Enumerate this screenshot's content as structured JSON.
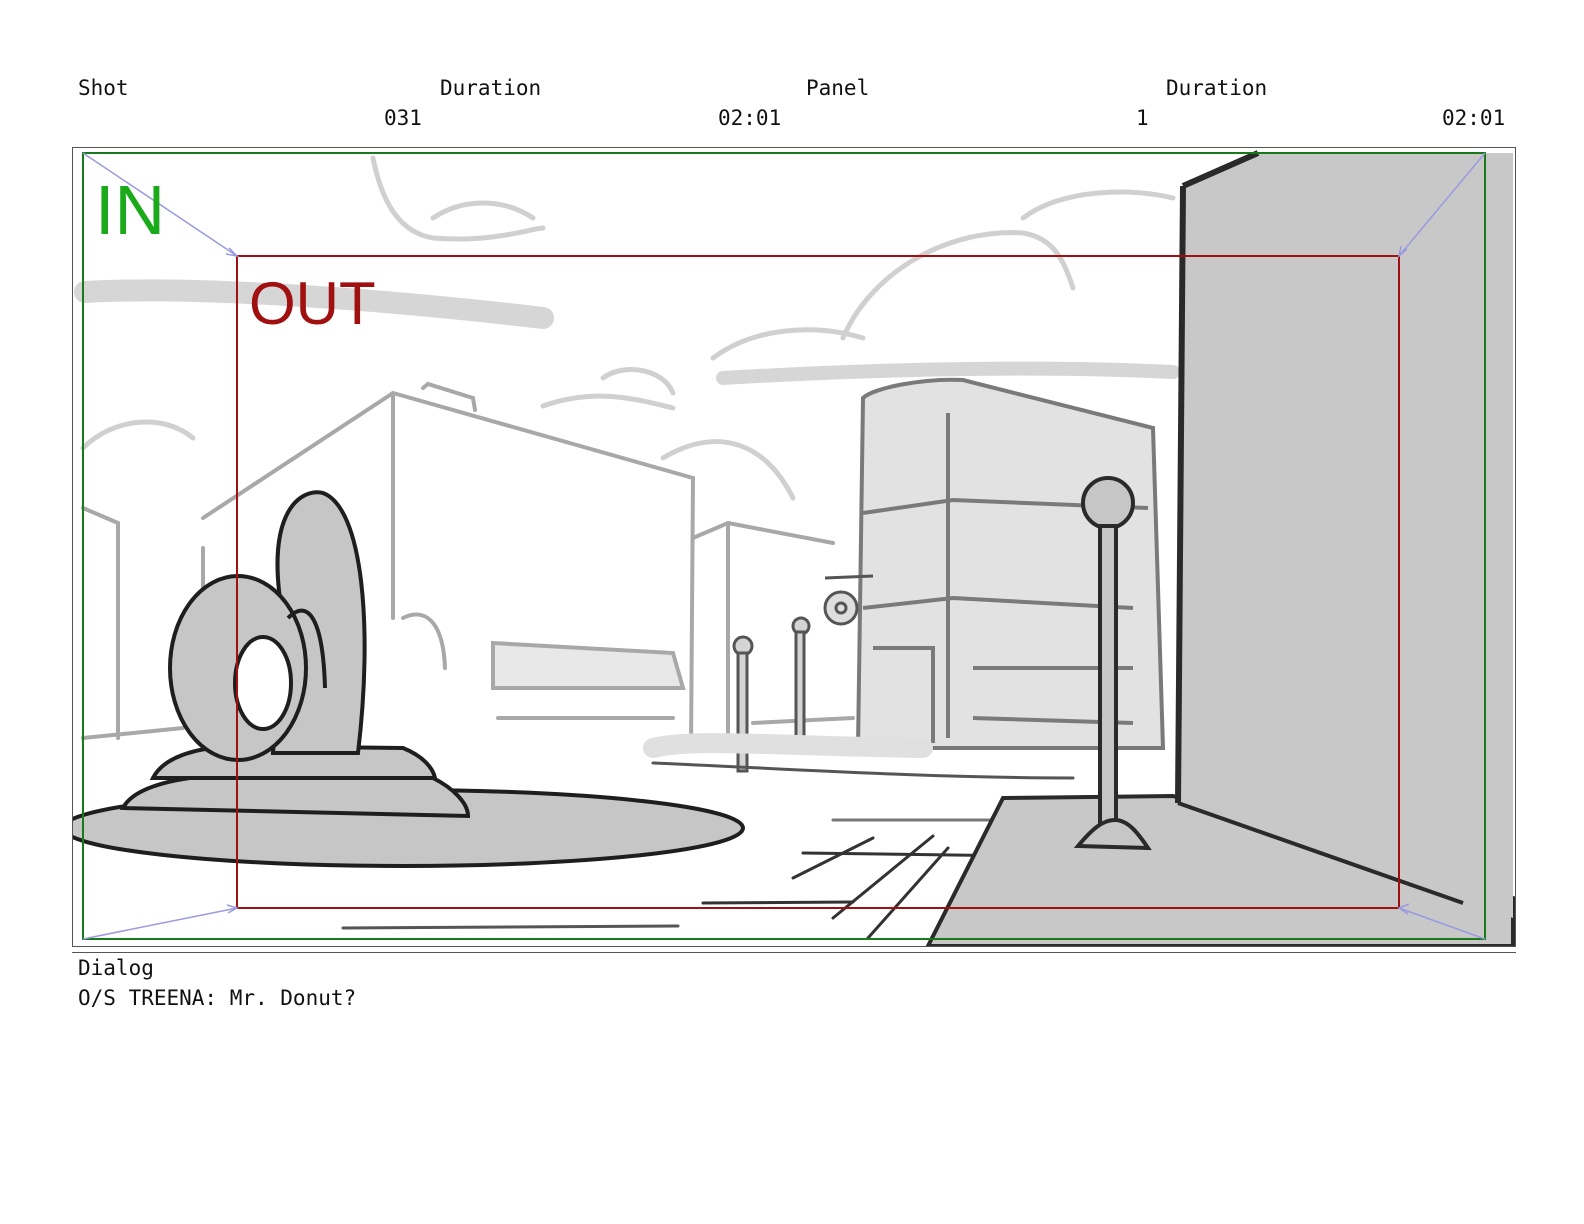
{
  "header": {
    "shot_label": "Shot",
    "duration_label": "Duration",
    "panel_label": "Panel",
    "panel_duration_label": "Duration",
    "shot_value": "031",
    "shot_duration_value": "02:01",
    "panel_value": "1",
    "panel_duration_value": "02:01"
  },
  "panel": {
    "in_label": "IN",
    "out_label": "OUT",
    "colors": {
      "in": "#1aaa1a",
      "out": "#a01010",
      "guide": "#9a9ae0",
      "sketch": "#c6c6c6",
      "ink": "#2a2a2a"
    }
  },
  "dialog": {
    "label": "Dialog",
    "text": "O/S TREENA: Mr. Donut?"
  }
}
